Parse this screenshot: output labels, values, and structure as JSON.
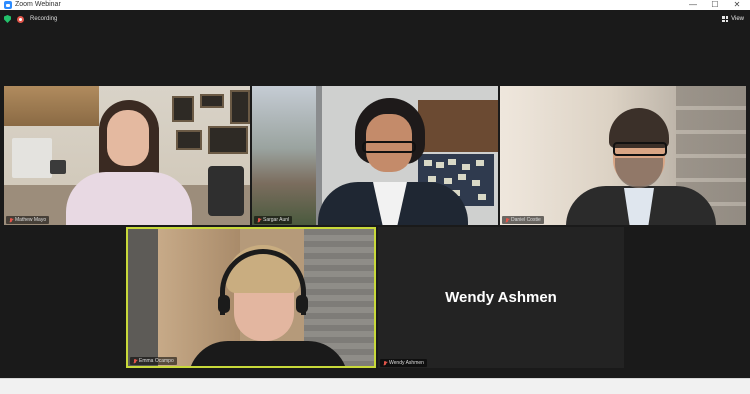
{
  "window": {
    "title": "Zoom Webinar",
    "minimize": "—",
    "maximize": "☐",
    "close": "✕"
  },
  "toolbar": {
    "recording_label": "Recording",
    "view_label": "View"
  },
  "participants": [
    {
      "name": "Mathew Mayo",
      "muted": true
    },
    {
      "name": "Sargar Aunl",
      "muted": true
    },
    {
      "name": "Daniel Costie",
      "muted": true
    },
    {
      "name": "Emma Ocampo",
      "muted": true,
      "active_speaker": true
    },
    {
      "name": "Wendy Ashmen",
      "muted": true,
      "video": false
    }
  ],
  "colors": {
    "accent_speaker": "#c8d93a",
    "recording": "#e2554a",
    "secure": "#23c16b",
    "background": "#1a1a1a"
  }
}
